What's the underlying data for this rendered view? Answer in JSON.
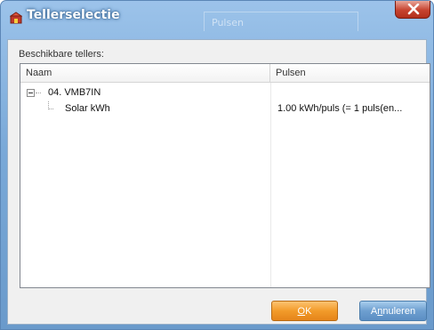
{
  "window": {
    "title": "Tellerselectie",
    "ghost_column_header": "Pulsen"
  },
  "dialog": {
    "available_label": "Beschikbare tellers:"
  },
  "list": {
    "columns": [
      "Naam",
      "Pulsen"
    ],
    "rows": [
      {
        "name": "04. VMB7IN",
        "pulses": "",
        "level": 0,
        "expanded": true
      },
      {
        "name": "Solar kWh",
        "pulses": "1.00 kWh/puls (= 1 puls(en...",
        "level": 1
      }
    ]
  },
  "buttons": {
    "ok_mnemonic": "O",
    "ok_rest": "K",
    "cancel_prefix": "A",
    "cancel_mnemonic": "n",
    "cancel_rest": "nuleren"
  },
  "colors": {
    "ok_button": "#f29b2a",
    "cancel_button": "#6e9fd0",
    "close_button": "#c7432f",
    "title_bar": "#7aa9d8"
  },
  "icons": {
    "title": "meter-icon",
    "close": "close-icon",
    "expander": "collapse-minus-icon"
  }
}
